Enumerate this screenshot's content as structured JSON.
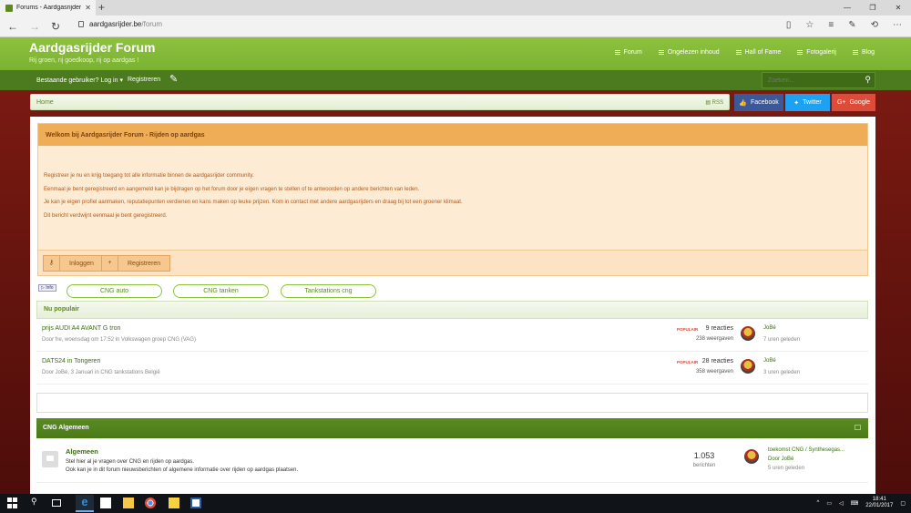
{
  "browser": {
    "tab_title": "Forums - Aardgasrijder",
    "tab_close": "✕",
    "new_tab": "+",
    "url_host": "aardgasrijder.be",
    "url_path": "/forum"
  },
  "site": {
    "title": "Aardgasrijder Forum",
    "subtitle": "Rij groen, rij goedkoop, rij op aardgas !",
    "nav": [
      {
        "label": "Forum"
      },
      {
        "label": "Ongelezen inhoud"
      },
      {
        "label": "Hall of Fame"
      },
      {
        "label": "Fotogalerij"
      },
      {
        "label": "Blog"
      }
    ],
    "login_label": "Bestaande gebruiker? Log in",
    "register_label": "Registreren",
    "search_placeholder": "Zoeken..."
  },
  "breadcrumb": {
    "home": "Home",
    "rss": "RSS"
  },
  "social": {
    "facebook": "Facebook",
    "twitter": "Twitter",
    "google": "Google"
  },
  "notice": {
    "title": "Welkom bij Aardgasrijder Forum - Rijden op aardgas",
    "lines": [
      "Registreer je nu en krijg toegang tot alle informatie binnen de aardgasrijder community.",
      "Eenmaal je bent geregistreerd en aangemeld kan je bijdragen op het forum door je eigen vragen te stellen of te antwoorden op andere berichten van leden.",
      "Je kan je eigen profiel aanmaken, reputatiepunten verdienen en kans maken op leuke prijzen. Kom in contact met andere aardgasrijders en draag bij tot een groener klimaat.",
      "Dit bericht verdwijnt eenmaal je bent geregistreerd."
    ],
    "login_btn": "Inloggen",
    "register_btn": "Registreren"
  },
  "info_tag": "Info",
  "quick_links": [
    "CNG auto",
    "CNG tanken",
    "Tankstations cng"
  ],
  "popular": {
    "heading": "Nu populair",
    "threads": [
      {
        "title": "prijs AUDI A4 AVANT G tron",
        "meta": "Door fre, woensdag om 17:52 in Volkswagen groep CNG (VAG)",
        "tag": "POPULAIR",
        "replies": "9 reacties",
        "views": "238 weergaven",
        "user": "JoBé",
        "time": "7 uren geleden"
      },
      {
        "title": "DATS24 in Tongeren",
        "meta": "Door JoBé, 3 Januari in CNG tankstations België",
        "tag": "POPULAIR",
        "replies": "28 reacties",
        "views": "358 weergaven",
        "user": "JoBé",
        "time": "3 uren geleden"
      }
    ]
  },
  "category": {
    "title": "CNG Algemeen",
    "forum": {
      "title": "Algemeen",
      "desc1": "Stel hier al je vragen over CNG en rijden op aardgas.",
      "desc2": "Ook kan je in dit forum nieuwsberichten of algemene informatie over rijden op aardgas plaatsen.",
      "count": "1.053",
      "count_label": "berichten",
      "last_title": "toekomst CNG / Synthesegas...",
      "last_by": "Door JoBé",
      "last_when": "5 uren geleden"
    }
  },
  "taskbar": {
    "time": "18:41",
    "date": "22/01/2017"
  }
}
